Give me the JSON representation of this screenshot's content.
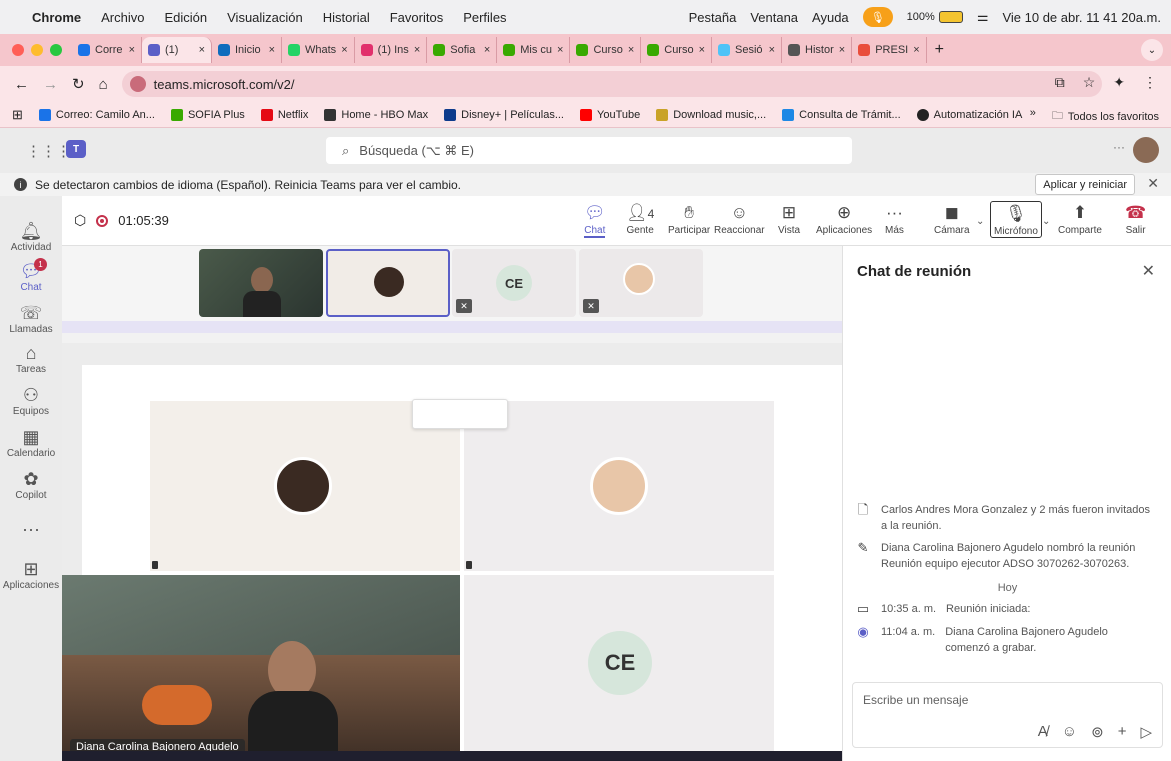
{
  "mac_menu": {
    "apple": "",
    "items": [
      "Chrome",
      "Archivo",
      "Edición",
      "Visualización",
      "Historial",
      "Favoritos",
      "Perfiles"
    ],
    "right_items": [
      "Pestaña",
      "Ventana",
      "Ayuda"
    ],
    "battery": "100%",
    "datetime": "Vie 10 de abr. 11 41 20a.m."
  },
  "tabs": [
    {
      "label": "Corre",
      "color": "#1a73e8"
    },
    {
      "label": "(1)",
      "color": "#5b5fc7"
    },
    {
      "label": "Inicio",
      "color": "#0f6cbd"
    },
    {
      "label": "Whats",
      "color": "#25d366"
    },
    {
      "label": "(1) Ins",
      "color": "#e1306c"
    },
    {
      "label": "Sofia",
      "color": "#39a900"
    },
    {
      "label": "Mis cu",
      "color": "#39a900"
    },
    {
      "label": "Curso",
      "color": "#39a900"
    },
    {
      "label": "Curso",
      "color": "#39a900"
    },
    {
      "label": "Sesió",
      "color": "#4fc3f7"
    },
    {
      "label": "Histor",
      "color": "#555555"
    },
    {
      "label": "PRESI",
      "color": "#e94e3c"
    }
  ],
  "address": {
    "url": "teams.microsoft.com/v2/"
  },
  "bookmarks": [
    "Correo: Camilo An...",
    "SOFIA Plus",
    "Netflix",
    "Home - HBO Max",
    "Disney+ | Películas...",
    "YouTube",
    "Download music,...",
    "Consulta de Trámit...",
    "Automatización IA"
  ],
  "bookmarks_more": "»",
  "bookmarks_all": "Todos los favoritos",
  "teams": {
    "search_placeholder": "Búsqueda (⌥ ⌘ E)",
    "notice": "Se detectaron cambios de idioma (Español). Reinicia Teams para ver el cambio.",
    "apply_label": "Aplicar y reiniciar"
  },
  "rail": [
    {
      "label": "Actividad",
      "icon": "bell-icon"
    },
    {
      "label": "Chat",
      "icon": "chat-icon"
    },
    {
      "label": "Llamadas",
      "icon": "phone-icon"
    },
    {
      "label": "Tareas",
      "icon": "tasks-icon"
    },
    {
      "label": "Equipos",
      "icon": "teams-icon"
    },
    {
      "label": "Calendario",
      "icon": "calendar-icon"
    },
    {
      "label": "Copilot",
      "icon": "copilot-icon"
    },
    {
      "label": "",
      "icon": "more-icon"
    },
    {
      "label": "Aplicaciones",
      "icon": "apps-icon"
    }
  ],
  "meeting": {
    "timer": "01:05:39",
    "people_count": "4",
    "controls": {
      "chat": "Chat",
      "people": "Gente",
      "raise": "Participar",
      "react": "Reaccionar",
      "view": "Vista",
      "apps": "Aplicaciones",
      "more": "Más",
      "camera": "Cámara",
      "mic": "Micrófono",
      "share": "Comparte",
      "leave": "Salir"
    }
  },
  "participants": {
    "ce_initials": "CE",
    "presenter_name": "Diana Carolina Bajonero Agudelo"
  },
  "chat": {
    "title": "Chat de reunión",
    "messages": [
      {
        "text": "Carlos Andres Mora Gonzalez y 2 más fueron invitados a la reunión."
      },
      {
        "text": "Diana Carolina Bajonero Agudelo nombró la reunión Reunión equipo ejecutor ADSO 3070262-3070263."
      },
      {
        "day": "Hoy"
      },
      {
        "time": "10:35 a. m.",
        "text": "Reunión iniciada:"
      },
      {
        "time": "11:04 a. m.",
        "text": "Diana Carolina Bajonero Agudelo comenzó a grabar."
      }
    ],
    "compose_placeholder": "Escribe un mensaje"
  }
}
